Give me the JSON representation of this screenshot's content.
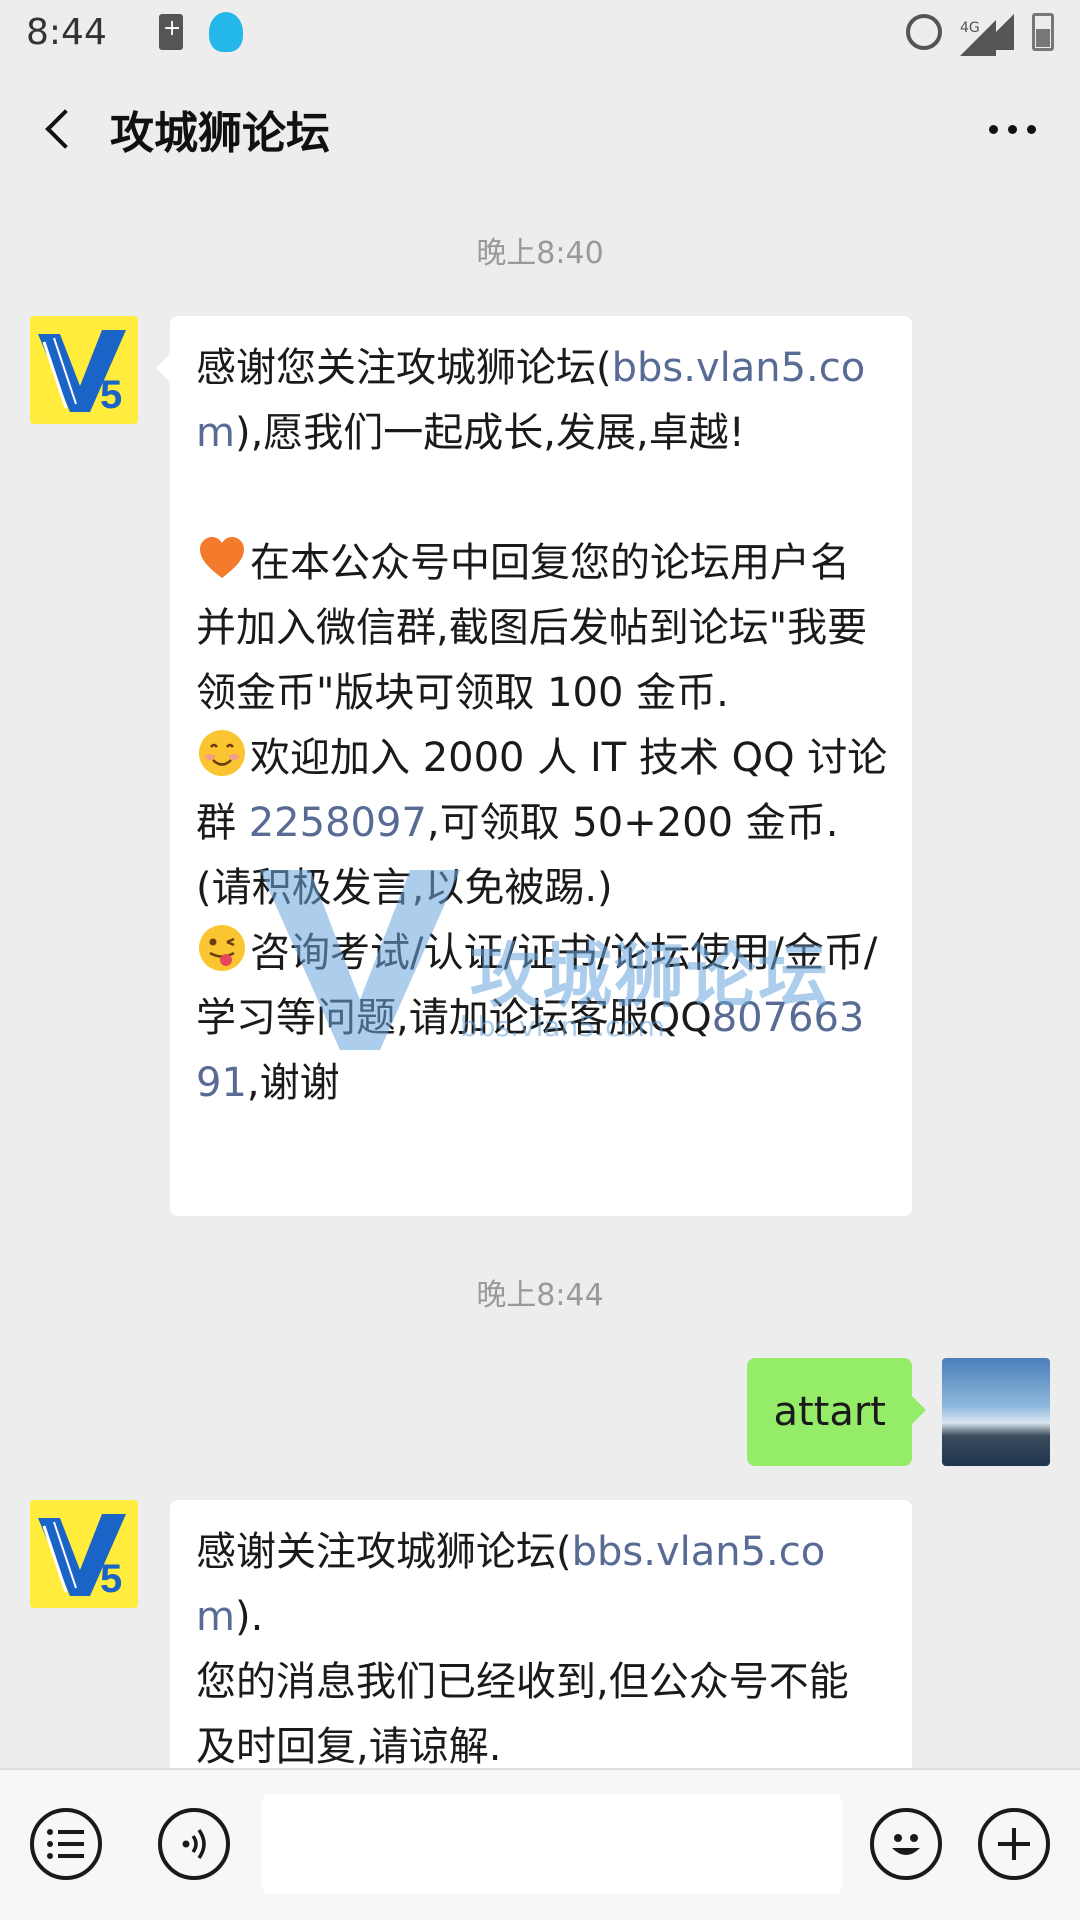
{
  "status_bar": {
    "time": "8:44",
    "network": "4G"
  },
  "header": {
    "title": "攻城狮论坛"
  },
  "messages": {
    "timestamp1": "晚上8:40",
    "msg1": {
      "p1_a": "感谢您关注攻城狮论坛(",
      "p1_link": "bbs.vlan5.com",
      "p1_b": "),愿我们一起成长,发展,卓越!",
      "p2": "在本公众号中回复您的论坛用户名并加入微信群,截图后发帖到论坛\"我要领金币\"版块可领取 100 金币.",
      "p3_a": "欢迎加入 2000 人 IT 技术 QQ 讨论群 ",
      "p3_link": "2258097",
      "p3_b": ",可领取 50+200 金币.(请积极发言,以免被踢.)",
      "p4_a": "咨询考试/认证/证书/论坛使用/金币/学习等问题,请加论坛客服QQ",
      "p4_link": "80766391",
      "p4_b": ",谢谢"
    },
    "timestamp2": "晚上8:44",
    "msg2": "attart",
    "msg3": {
      "a": "感谢关注攻城狮论坛(",
      "link": "bbs.vlan5.com",
      "b": ").",
      "c": "您的消息我们已经收到,但公众号不能及时回复,请谅解."
    }
  },
  "watermark": {
    "text": "攻城狮论坛",
    "sub": "bbs.vlan5.com"
  },
  "bottom_bar": {
    "input_placeholder": ""
  },
  "icons": {
    "back": "chevron-left-icon",
    "more": "more-dots-icon",
    "menu": "list-menu-icon",
    "voice": "voice-icon",
    "emoji": "emoji-icon",
    "plus": "plus-icon"
  },
  "colors": {
    "background": "#ededed",
    "bubble_in": "#ffffff",
    "bubble_out": "#95ec69",
    "link": "#576b95",
    "logo_bg": "#ffec3d"
  }
}
